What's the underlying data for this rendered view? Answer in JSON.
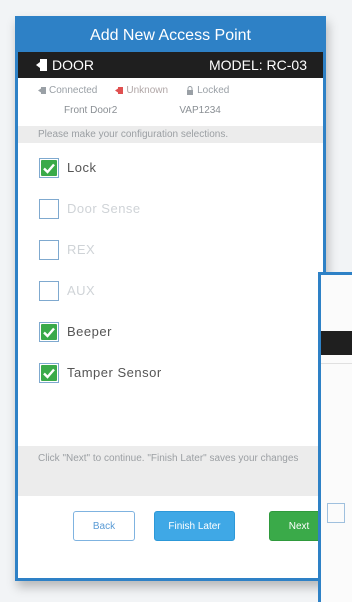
{
  "dialog": {
    "title": "Add New Access Point",
    "device_type": "DOOR",
    "model": "MODEL: RC-03",
    "status": {
      "connected": "Connected",
      "unknown": "Unknown",
      "locked": "Locked"
    },
    "door_name": "Front Door2",
    "vap_id": "VAP1234",
    "instruction": "Please make your configuration selections.",
    "options": [
      {
        "label": "Lock",
        "checked": true
      },
      {
        "label": "Door Sense",
        "checked": false
      },
      {
        "label": "REX",
        "checked": false
      },
      {
        "label": "AUX",
        "checked": false
      },
      {
        "label": "Beeper",
        "checked": true
      },
      {
        "label": "Tamper Sensor",
        "checked": true
      }
    ],
    "footer_note": "Click \"Next\" to continue. \"Finish Later\" saves your changes",
    "buttons": {
      "back": "Back",
      "finish_later": "Finish Later",
      "next": "Next"
    }
  },
  "colors": {
    "accent": "#2e81c6",
    "header_dark": "#1f1f1f",
    "check_green": "#3aaa49",
    "finish_blue": "#3fa8e6"
  }
}
